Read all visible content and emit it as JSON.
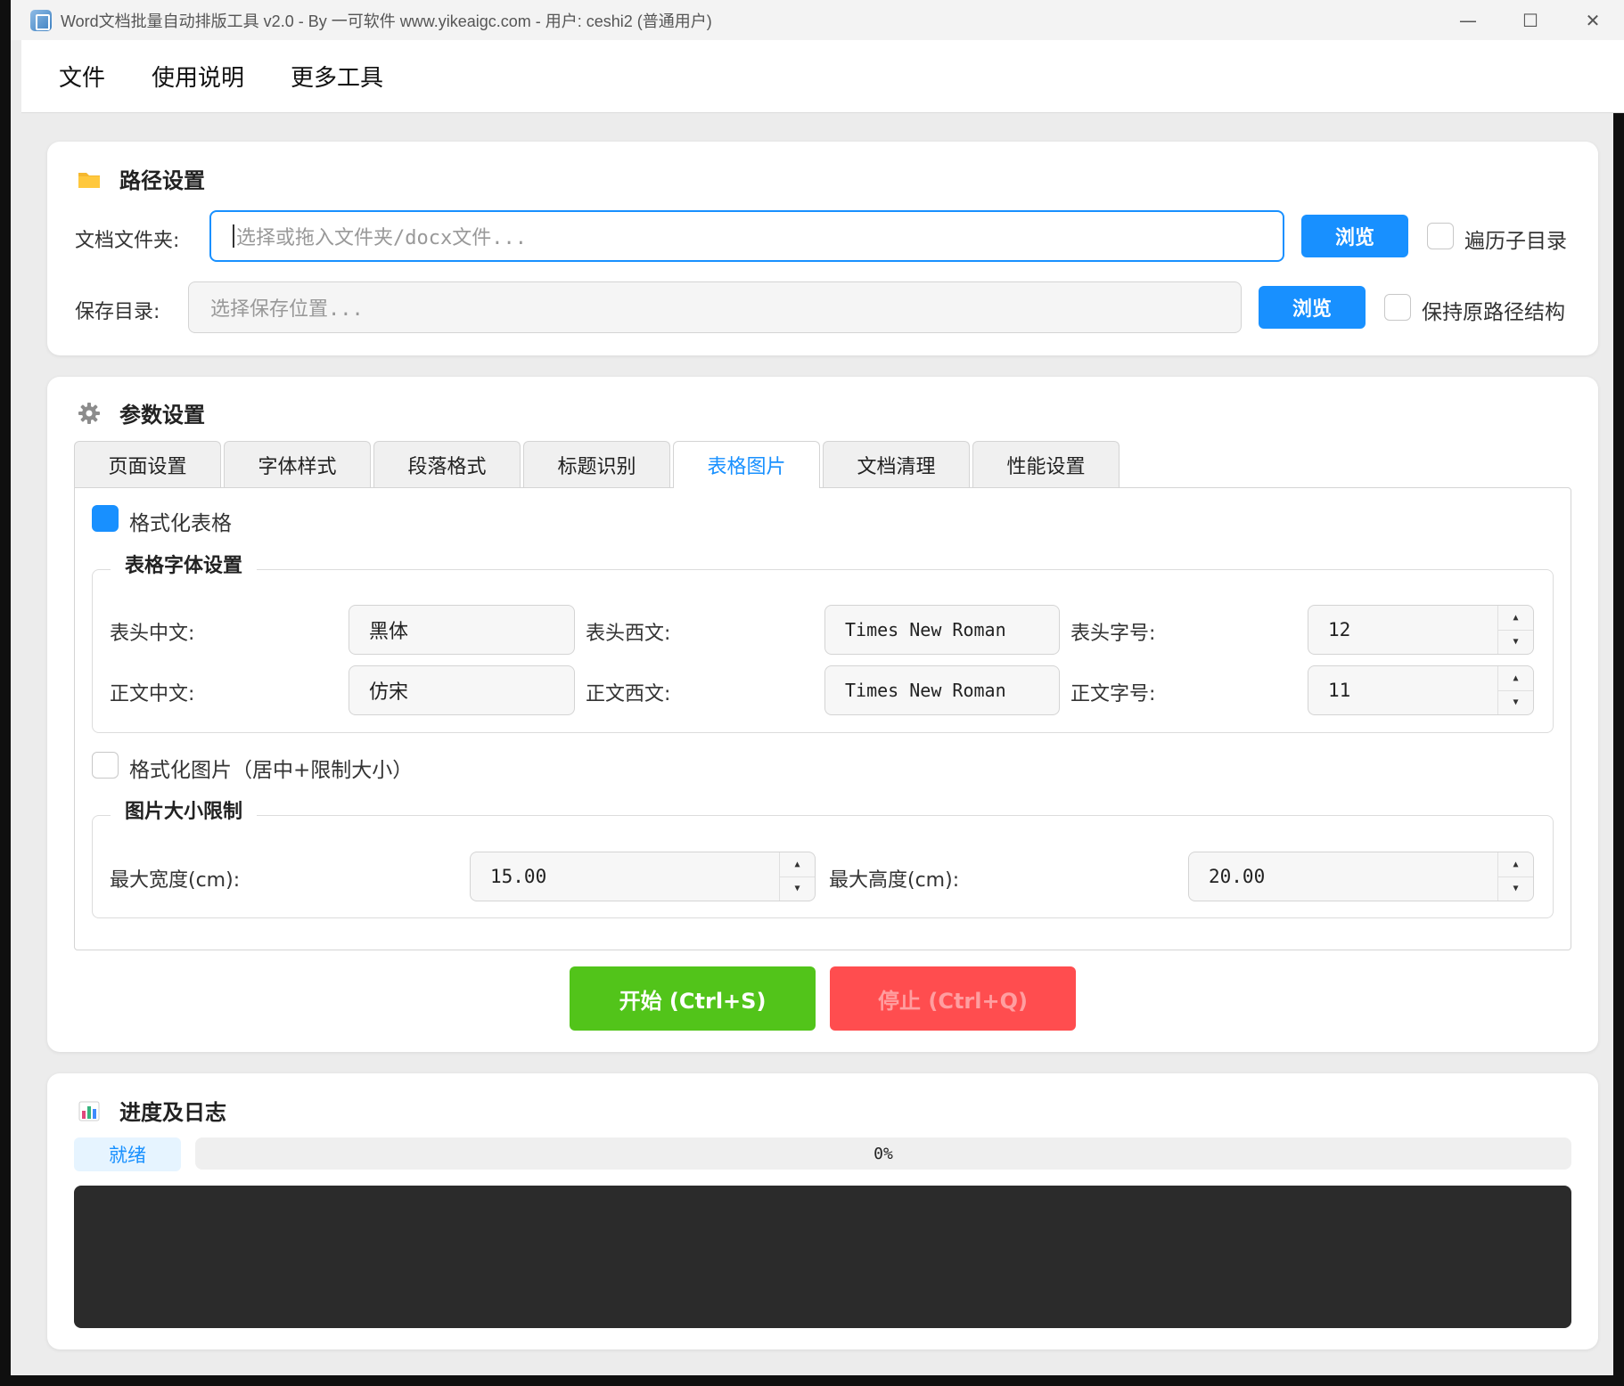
{
  "window": {
    "title": "Word文档批量自动排版工具 v2.0 - By 一可软件 www.yikeaigc.com - 用户: ceshi2 (普通用户)",
    "minimize": "—",
    "maximize": "☐",
    "close": "✕"
  },
  "menu": [
    "文件",
    "使用说明",
    "更多工具"
  ],
  "path_settings": {
    "title": "路径设置",
    "icon": "folder-icon",
    "doc_folder_label": "文档文件夹:",
    "doc_folder_placeholder": "选择或拖入文件夹/docx文件...",
    "browse_label": "浏览",
    "recursive_label": "遍历子目录",
    "recursive_checked": false,
    "save_dir_label": "保存目录:",
    "save_dir_placeholder": "选择保存位置...",
    "keep_structure_label": "保持原路径结构",
    "keep_structure_checked": false
  },
  "params": {
    "title": "参数设置",
    "icon": "gear-icon",
    "tabs": [
      "页面设置",
      "字体样式",
      "段落格式",
      "标题识别",
      "表格图片",
      "文档清理",
      "性能设置"
    ],
    "active_tab": "表格图片",
    "format_table_label": "格式化表格",
    "format_table_checked": true,
    "table_font_group": "表格字体设置",
    "header_cn_label": "表头中文:",
    "header_cn_value": "黑体",
    "header_west_label": "表头西文:",
    "header_west_value": "Times New Roman",
    "header_size_label": "表头字号:",
    "header_size_value": "12",
    "body_cn_label": "正文中文:",
    "body_cn_value": "仿宋",
    "body_west_label": "正文西文:",
    "body_west_value": "Times New Roman",
    "body_size_label": "正文字号:",
    "body_size_value": "11",
    "format_image_label": "格式化图片（居中+限制大小）",
    "format_image_checked": false,
    "image_group": "图片大小限制",
    "max_width_label": "最大宽度(cm):",
    "max_width_value": "15.00",
    "max_height_label": "最大高度(cm):",
    "max_height_value": "20.00",
    "start_label": "开始 (Ctrl+S)",
    "stop_label": "停止 (Ctrl+Q)"
  },
  "progress": {
    "title": "进度及日志",
    "icon": "bar-chart-icon",
    "status": "就绪",
    "percent_text": "0%",
    "percent": 0,
    "log_text": ""
  },
  "colors": {
    "accent": "#1890ff",
    "start": "#52c41a",
    "stop": "#ff4d4f",
    "log_bg": "#2b2b2b"
  }
}
